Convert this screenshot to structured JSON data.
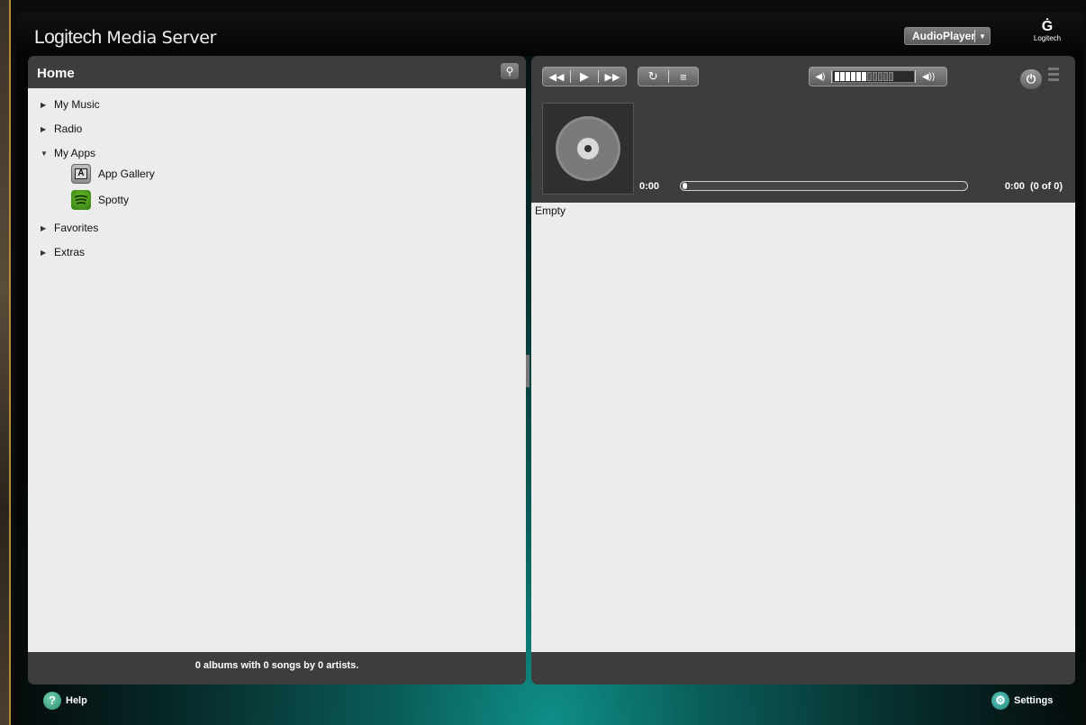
{
  "app": {
    "title_brand": "Logitech",
    "title_rest": " Media Server",
    "player_name": "AudioPlayer",
    "logo_text": "Logitech"
  },
  "left_panel": {
    "title": "Home",
    "tree": [
      {
        "label": "My Music",
        "expanded": false
      },
      {
        "label": "Radio",
        "expanded": false
      },
      {
        "label": "My Apps",
        "expanded": true
      },
      {
        "label": "Favorites",
        "expanded": false
      },
      {
        "label": "Extras",
        "expanded": false
      }
    ],
    "apps": [
      {
        "label": "App Gallery",
        "icon": "app-gallery-icon"
      },
      {
        "label": "Spotty",
        "icon": "spotty-icon"
      }
    ],
    "footer": "0 albums with 0 songs by 0 artists."
  },
  "right_panel": {
    "time_current": "0:00",
    "time_total": "0:00  (0 of 0)",
    "progress": 0,
    "volume_level_segments": 6,
    "volume_total_segments": 11,
    "playlist_status": "Empty"
  },
  "bottom": {
    "help_label": "Help",
    "settings_label": "Settings"
  },
  "colors": {
    "accent_teal": "#0f8f88",
    "panel": "#3d3d3d",
    "content_bg": "#ececec"
  }
}
